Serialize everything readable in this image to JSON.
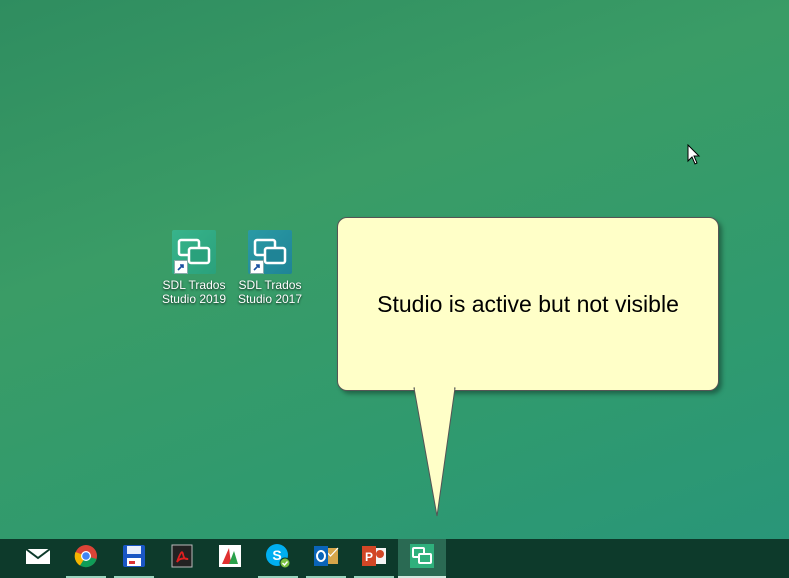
{
  "desktop": {
    "icons": [
      {
        "label_line1": "SDL Trados",
        "label_line2": "Studio 2019",
        "icon": "trados-studio-icon"
      },
      {
        "label_line1": "SDL Trados",
        "label_line2": "Studio 2017",
        "icon": "trados-studio-icon"
      }
    ]
  },
  "callout": {
    "text": "Studio is active but not visible"
  },
  "taskbar": {
    "items": [
      {
        "icon": "mail-icon",
        "running": false
      },
      {
        "icon": "chrome-icon",
        "running": true
      },
      {
        "icon": "save-disk-icon",
        "running": true
      },
      {
        "icon": "acrobat-icon",
        "running": false
      },
      {
        "icon": "multiterm-icon",
        "running": false
      },
      {
        "icon": "skype-icon",
        "running": true
      },
      {
        "icon": "outlook-icon",
        "running": true
      },
      {
        "icon": "powerpoint-icon",
        "running": true
      },
      {
        "icon": "trados-studio-icon",
        "running": true,
        "active": true
      }
    ]
  },
  "colors": {
    "callout_bg": "#ffffc8",
    "taskbar_bg": "#0d3a2b",
    "desktop_bg": "#3a9c66"
  }
}
